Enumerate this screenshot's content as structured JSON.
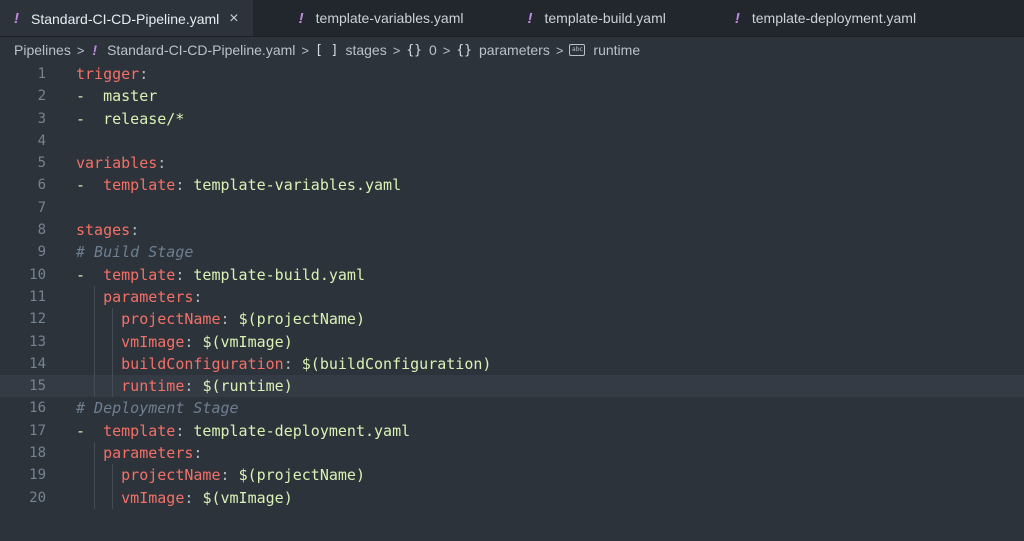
{
  "tabs": [
    {
      "label": "Standard-CI-CD-Pipeline.yaml",
      "close": "×"
    },
    {
      "label": "template-variables.yaml"
    },
    {
      "label": "template-build.yaml"
    },
    {
      "label": "template-deployment.yaml"
    }
  ],
  "file_icon_glyph": "!",
  "breadcrumb": {
    "items": [
      {
        "label": "Pipelines",
        "icon": ""
      },
      {
        "label": "Standard-CI-CD-Pipeline.yaml",
        "icon": "!"
      },
      {
        "label": "stages",
        "icon": "[ ]"
      },
      {
        "label": "0",
        "icon": "{}"
      },
      {
        "label": "parameters",
        "icon": "{}"
      },
      {
        "label": "runtime",
        "icon": "abc"
      }
    ],
    "separator": ">"
  },
  "editor": {
    "lines": [
      {
        "n": "1",
        "parts": [
          {
            "t": "trigger",
            "c": "k"
          },
          {
            "t": ":",
            "c": "p"
          }
        ],
        "indent": 0
      },
      {
        "n": "2",
        "parts": [
          {
            "t": "-  ",
            "c": "v"
          },
          {
            "t": "master",
            "c": "v"
          }
        ],
        "indent": 0
      },
      {
        "n": "3",
        "parts": [
          {
            "t": "-  ",
            "c": "v"
          },
          {
            "t": "release/*",
            "c": "v"
          }
        ],
        "indent": 0
      },
      {
        "n": "4",
        "parts": [],
        "indent": 0
      },
      {
        "n": "5",
        "parts": [
          {
            "t": "variables",
            "c": "k"
          },
          {
            "t": ":",
            "c": "p"
          }
        ],
        "indent": 0
      },
      {
        "n": "6",
        "parts": [
          {
            "t": "-  ",
            "c": "v"
          },
          {
            "t": "template",
            "c": "k"
          },
          {
            "t": ": ",
            "c": "p"
          },
          {
            "t": "template-variables.yaml",
            "c": "v"
          }
        ],
        "indent": 0
      },
      {
        "n": "7",
        "parts": [],
        "indent": 0
      },
      {
        "n": "8",
        "parts": [
          {
            "t": "stages",
            "c": "k"
          },
          {
            "t": ":",
            "c": "p"
          }
        ],
        "indent": 0
      },
      {
        "n": "9",
        "parts": [
          {
            "t": "# Build Stage",
            "c": "c"
          }
        ],
        "indent": 0
      },
      {
        "n": "10",
        "parts": [
          {
            "t": "-  ",
            "c": "v"
          },
          {
            "t": "template",
            "c": "k"
          },
          {
            "t": ": ",
            "c": "p"
          },
          {
            "t": "template-build.yaml",
            "c": "v"
          }
        ],
        "indent": 0
      },
      {
        "n": "11",
        "parts": [
          {
            "t": "   ",
            "c": "p"
          },
          {
            "t": "parameters",
            "c": "k"
          },
          {
            "t": ":",
            "c": "p"
          }
        ],
        "indent": 1
      },
      {
        "n": "12",
        "parts": [
          {
            "t": "     ",
            "c": "p"
          },
          {
            "t": "projectName",
            "c": "k"
          },
          {
            "t": ": ",
            "c": "p"
          },
          {
            "t": "$(projectName)",
            "c": "v"
          }
        ],
        "indent": 2
      },
      {
        "n": "13",
        "parts": [
          {
            "t": "     ",
            "c": "p"
          },
          {
            "t": "vmImage",
            "c": "k"
          },
          {
            "t": ": ",
            "c": "p"
          },
          {
            "t": "$(vmImage)",
            "c": "v"
          }
        ],
        "indent": 2
      },
      {
        "n": "14",
        "parts": [
          {
            "t": "     ",
            "c": "p"
          },
          {
            "t": "buildConfiguration",
            "c": "k"
          },
          {
            "t": ": ",
            "c": "p"
          },
          {
            "t": "$(buildConfiguration)",
            "c": "v"
          }
        ],
        "indent": 2
      },
      {
        "n": "15",
        "parts": [
          {
            "t": "     ",
            "c": "p"
          },
          {
            "t": "runtime",
            "c": "k"
          },
          {
            "t": ": ",
            "c": "p"
          },
          {
            "t": "$(runtime)",
            "c": "v"
          }
        ],
        "indent": 2,
        "current": true
      },
      {
        "n": "16",
        "parts": [
          {
            "t": "# Deployment Stage",
            "c": "c"
          }
        ],
        "indent": 0
      },
      {
        "n": "17",
        "parts": [
          {
            "t": "-  ",
            "c": "v"
          },
          {
            "t": "template",
            "c": "k"
          },
          {
            "t": ": ",
            "c": "p"
          },
          {
            "t": "template-deployment.yaml",
            "c": "v"
          }
        ],
        "indent": 0
      },
      {
        "n": "18",
        "parts": [
          {
            "t": "   ",
            "c": "p"
          },
          {
            "t": "parameters",
            "c": "k"
          },
          {
            "t": ":",
            "c": "p"
          }
        ],
        "indent": 1
      },
      {
        "n": "19",
        "parts": [
          {
            "t": "     ",
            "c": "p"
          },
          {
            "t": "projectName",
            "c": "k"
          },
          {
            "t": ": ",
            "c": "p"
          },
          {
            "t": "$(projectName)",
            "c": "v"
          }
        ],
        "indent": 2
      },
      {
        "n": "20",
        "parts": [
          {
            "t": "     ",
            "c": "p"
          },
          {
            "t": "vmImage",
            "c": "k"
          },
          {
            "t": ": ",
            "c": "p"
          },
          {
            "t": "$(vmImage)",
            "c": "v"
          }
        ],
        "indent": 2
      }
    ]
  },
  "colors": {
    "key": "#f47067",
    "value": "#d9f2b4",
    "comment": "#6e7f91",
    "yaml_icon": "#c18ae0",
    "editor_bg": "#2d333b"
  }
}
